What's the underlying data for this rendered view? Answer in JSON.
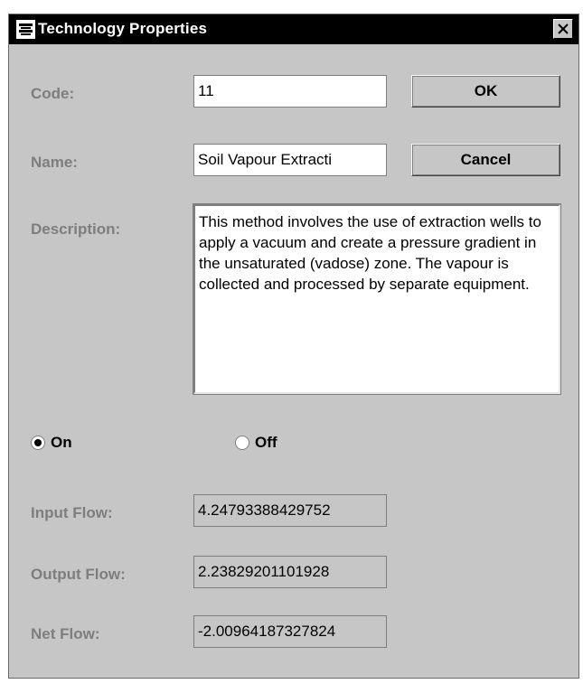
{
  "window": {
    "title": "Technology Properties",
    "close_symbol": "✕",
    "app_icon": "app-icon"
  },
  "form": {
    "code_label": "Code:",
    "code_value": "11",
    "name_label": "Name:",
    "name_value": "Soil Vapour Extracti",
    "description_label": "Description:",
    "description_value": "This method involves the use of extraction wells to apply a vacuum and create a pressure gradient in the unsaturated (vadose) zone. The vapour is collected and processed by separate equipment."
  },
  "buttons": {
    "ok_label": "OK",
    "cancel_label": "Cancel"
  },
  "radio": {
    "on_label": "On",
    "off_label": "Off",
    "selected": "On"
  },
  "flows": {
    "input_label": "Input Flow:",
    "input_value": "4.24793388429752",
    "output_label": "Output Flow:",
    "output_value": "2.23829201101928",
    "net_label": "Net Flow:",
    "net_value": "-2.00964187327824"
  }
}
